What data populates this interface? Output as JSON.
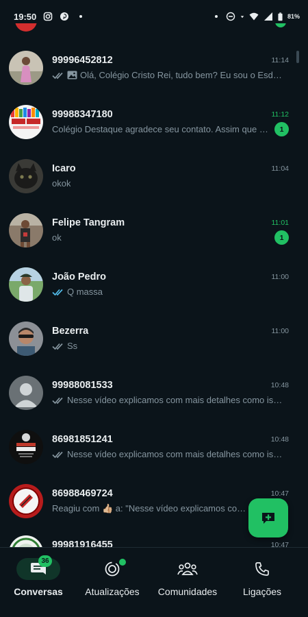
{
  "status_bar": {
    "time": "19:50",
    "battery": "81%",
    "left_icons": [
      "instagram-icon",
      "pinterest-icon",
      "dot-icon"
    ],
    "right_icons": [
      "dot-icon",
      "do-not-disturb-icon",
      "data-arrow-icon",
      "wifi-icon",
      "signal-icon",
      "battery-icon"
    ]
  },
  "colors": {
    "background": "#0b141a",
    "accent": "#21c063",
    "secondary_text": "#8696a0",
    "read_tick": "#53bdeb"
  },
  "chats": [
    {
      "name": "99996452812",
      "time": "11:14",
      "preview": "Olá, Colégio Cristo Rei, tudo bem? Eu sou o Esdras",
      "status": "read-grey",
      "has_image": true,
      "unread": null,
      "avatar": "photo-person-pink"
    },
    {
      "name": "99988347180",
      "time": "11:12",
      "preview": "Colégio Destaque agradece seu contato. Assim que possível",
      "status": null,
      "has_image": false,
      "unread": "1",
      "avatar": "logo-destaque"
    },
    {
      "name": "Icaro",
      "time": "11:04",
      "preview": "okok",
      "status": null,
      "has_image": false,
      "unread": null,
      "avatar": "photo-cat"
    },
    {
      "name": "Felipe Tangram",
      "time": "11:01",
      "preview": "ok",
      "status": null,
      "has_image": false,
      "unread": "1",
      "avatar": "photo-runner"
    },
    {
      "name": "João Pedro",
      "time": "11:00",
      "preview": "Q massa",
      "status": "read-blue",
      "has_image": false,
      "unread": null,
      "avatar": "photo-outdoor"
    },
    {
      "name": "Bezerra",
      "time": "11:00",
      "preview": "Ss",
      "status": "read-grey",
      "has_image": false,
      "unread": null,
      "avatar": "photo-sunglasses"
    },
    {
      "name": "99988081533",
      "time": "10:48",
      "preview": "Nesse vídeo explicamos com mais detalhes como isso funciona",
      "status": "read-grey",
      "has_image": false,
      "unread": null,
      "avatar": "default-person"
    },
    {
      "name": "86981851241",
      "time": "10:48",
      "preview": "Nesse vídeo explicamos com mais detalhes como isso funciona",
      "status": "read-grey",
      "has_image": false,
      "unread": null,
      "avatar": "logo-pesar"
    },
    {
      "name": "86988469724",
      "time": "10:47",
      "preview": "Reagiu com 👍🏼 a: \"Nesse vídeo explicamos com mais detalhes\"",
      "status": null,
      "has_image": false,
      "unread": null,
      "avatar": "logo-circle-red"
    },
    {
      "name": "99981916455",
      "time": "10:47",
      "preview": "",
      "status": null,
      "has_image": false,
      "unread": null,
      "avatar": "logo-partial"
    }
  ],
  "fab": {
    "icon": "new-chat-icon"
  },
  "bottom_nav": [
    {
      "label": "Conversas",
      "icon": "chats-icon",
      "active": true,
      "badge": "36"
    },
    {
      "label": "Atualizações",
      "icon": "updates-icon",
      "active": false,
      "dot": true
    },
    {
      "label": "Comunidades",
      "icon": "communities-icon",
      "active": false
    },
    {
      "label": "Ligações",
      "icon": "calls-icon",
      "active": false
    }
  ]
}
